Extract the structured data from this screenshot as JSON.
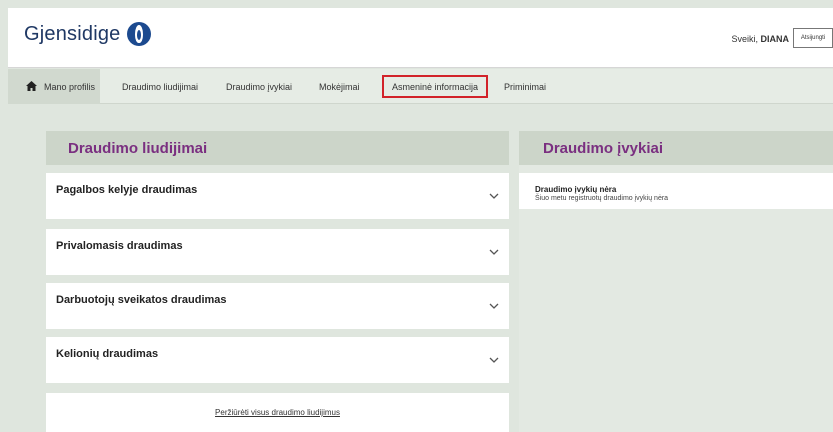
{
  "header": {
    "logo_text": "Gjensidige",
    "greeting_prefix": "Sveiki,",
    "user_name": "DIANA",
    "logout_label": "Atsijungti"
  },
  "nav": {
    "items": [
      {
        "label": "Mano profilis"
      },
      {
        "label": "Draudimo liudijimai"
      },
      {
        "label": "Draudimo įvykiai"
      },
      {
        "label": "Mokėjimai"
      },
      {
        "label": "Asmeninė informacija"
      },
      {
        "label": "Priminimai"
      }
    ]
  },
  "left_panel": {
    "title": "Draudimo liudijimai",
    "cards": [
      {
        "title": "Pagalbos kelyje draudimas"
      },
      {
        "title": "Privalomasis draudimas"
      },
      {
        "title": "Darbuotojų sveikatos draudimas"
      },
      {
        "title": "Kelionių draudimas"
      }
    ],
    "view_all_link": "Peržiūrėti visus draudimo liudijimus"
  },
  "right_panel": {
    "title": "Draudimo įvykiai",
    "empty_title": "Draudimo įvykių nėra",
    "empty_subtitle": "Šiuo metu registruotų draudimo įvykių nėra"
  },
  "colors": {
    "accent_purple": "#7a2f80",
    "logo_blue": "#1c4a8f",
    "highlight_red": "#d2232a",
    "background": "#dfe6de"
  },
  "icons": {
    "home": "home-icon",
    "chevron": "chevron-down-icon"
  }
}
